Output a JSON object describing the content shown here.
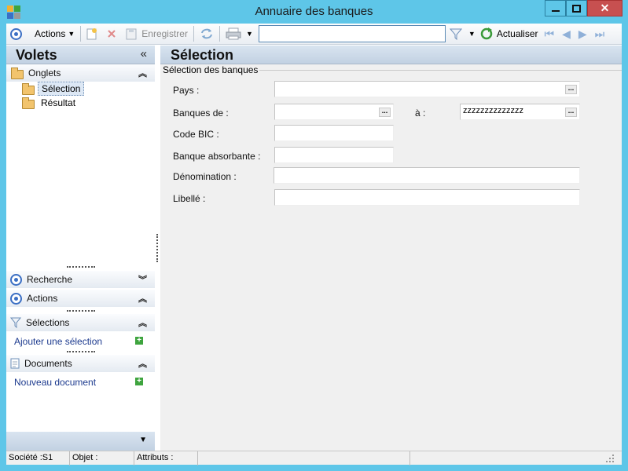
{
  "window": {
    "title": "Annuaire des banques",
    "close_glyph": "✕"
  },
  "toolbar": {
    "actions_label": "Actions",
    "save_label": "Enregistrer",
    "search_value": "",
    "refresh_label": "Actualiser"
  },
  "left_pane": {
    "title": "Volets",
    "collapse_glyph": "«",
    "onglets_label": "Onglets",
    "tree": [
      {
        "label": "Sélection",
        "selected": true
      },
      {
        "label": "Résultat",
        "selected": false
      }
    ],
    "sections": {
      "recherche": "Recherche",
      "actions": "Actions",
      "selections": "Sélections",
      "documents": "Documents"
    },
    "add_selection_link": "Ajouter une sélection",
    "new_document_link": "Nouveau document",
    "plus_glyph": "+"
  },
  "main": {
    "title": "Sélection",
    "group_title": "Sélection des banques",
    "fields": {
      "pays_label": "Pays :",
      "pays_value": "",
      "banques_de_label": "Banques de :",
      "banques_de_value": "",
      "a_label": "à :",
      "a_value": "zzzzzzzzzzzzzz",
      "code_bic_label": "Code BIC :",
      "code_bic_value": "",
      "banque_absorbante_label": "Banque absorbante :",
      "banque_absorbante_value": "",
      "denomination_label": "Dénomination :",
      "denomination_value": "",
      "libelle_label": "Libellé :",
      "libelle_value": ""
    },
    "browse_glyph": "..."
  },
  "status_bar": {
    "societe": "Société :S1",
    "objet": "Objet :",
    "attributs": "Attributs :"
  },
  "colors": {
    "window_frame": "#5ec6e8",
    "accent": "#3b6fc4",
    "link": "#1c3a8e",
    "add_green": "#3ea43e"
  }
}
